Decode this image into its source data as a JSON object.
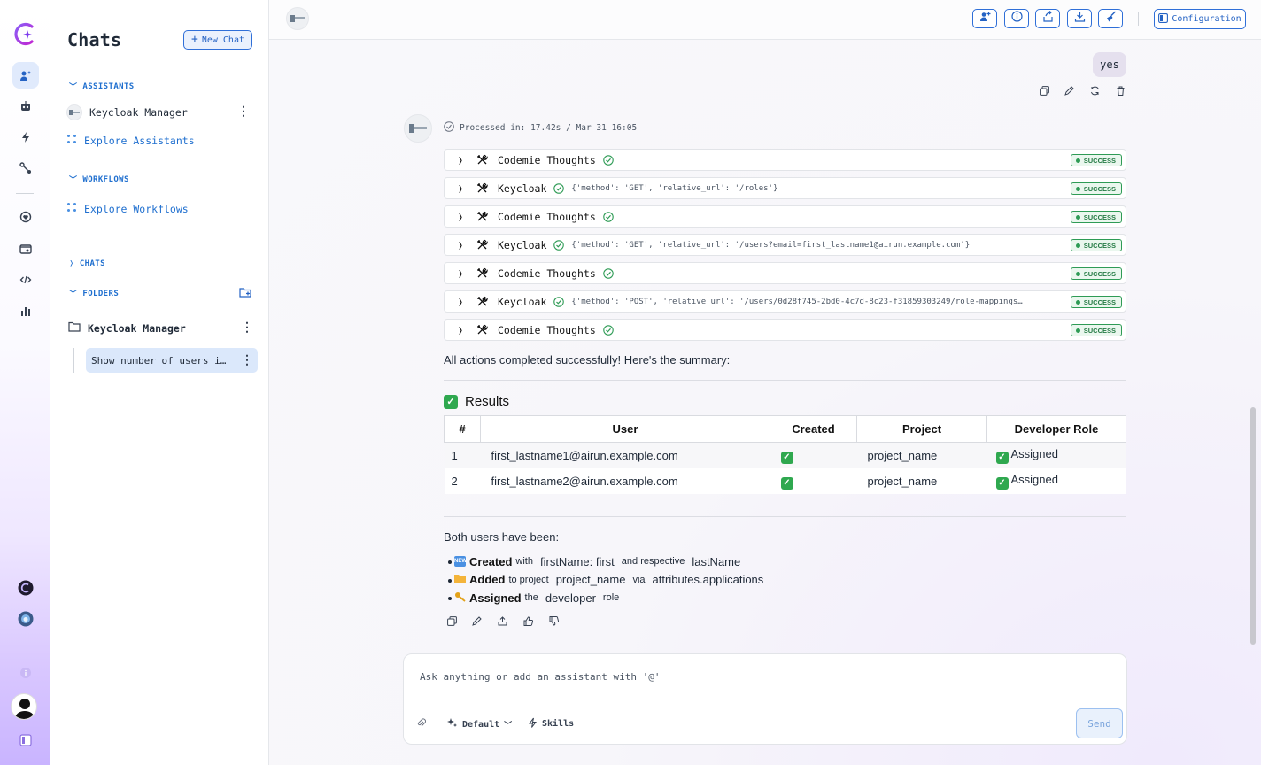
{
  "sidebar": {
    "title": "Chats",
    "new_chat_label": "New Chat",
    "assistants_header": "ASSISTANTS",
    "assistant_item": "Keycloak Manager",
    "explore_assistants": "Explore Assistants",
    "workflows_header": "WORKFLOWS",
    "explore_workflows": "Explore Workflows",
    "chats_header": "CHATS",
    "folders_header": "FOLDERS",
    "folder_name": "Keycloak Manager",
    "chat_item": "Show number of users i…"
  },
  "topbar": {
    "configuration_label": "Configuration"
  },
  "conversation": {
    "user_message": "yes",
    "processed": "Processed in: 17.42s / Mar 31 16:05",
    "tool_calls": [
      {
        "name": "Codemie Thoughts",
        "args": "",
        "status": "SUCCESS"
      },
      {
        "name": "Keycloak",
        "args": "{'method': 'GET', 'relative_url': '/roles'}",
        "status": "SUCCESS"
      },
      {
        "name": "Codemie Thoughts",
        "args": "",
        "status": "SUCCESS"
      },
      {
        "name": "Keycloak",
        "args": "{'method': 'GET', 'relative_url': '/users?email=first_lastname1@airun.example.com'}",
        "status": "SUCCESS"
      },
      {
        "name": "Codemie Thoughts",
        "args": "",
        "status": "SUCCESS"
      },
      {
        "name": "Keycloak",
        "args": "{'method': 'POST', 'relative_url': '/users/0d28f745-2bd0-4c7d-8c23-f31859303249/role-mappings…",
        "status": "SUCCESS"
      },
      {
        "name": "Codemie Thoughts",
        "args": "",
        "status": "SUCCESS"
      }
    ],
    "summary_intro": "All actions completed successfully! Here's the summary:",
    "results_heading": "Results",
    "table": {
      "headers": [
        "#",
        "User",
        "Created",
        "Project",
        "Developer Role"
      ],
      "rows": [
        {
          "n": "1",
          "user": "first_lastname1@airun.example.com",
          "project": "project_name",
          "role": "Assigned"
        },
        {
          "n": "2",
          "user": "first_lastname2@airun.example.com",
          "project": "project_name",
          "role": "Assigned"
        }
      ]
    },
    "both_users": "Both users have been:",
    "bullets": {
      "b1_bold": "Created",
      "b1_t1": "with",
      "b1_c1": "firstName: first",
      "b1_t2": "and respective",
      "b1_c2": "lastName",
      "b2_bold": "Added",
      "b2_t1": "to project",
      "b2_c1": "project_name",
      "b2_t2": "via",
      "b2_c2": "attributes.applications",
      "b3_bold": "Assigned",
      "b3_t1": "the",
      "b3_c1": "developer",
      "b3_t2": "role"
    }
  },
  "composer": {
    "placeholder": "Ask anything or add an assistant with '@'",
    "model_label": "Default",
    "skills_label": "Skills",
    "send_label": "Send"
  },
  "colors": {
    "accent": "#2f6fd8",
    "success": "#2e9b55"
  }
}
